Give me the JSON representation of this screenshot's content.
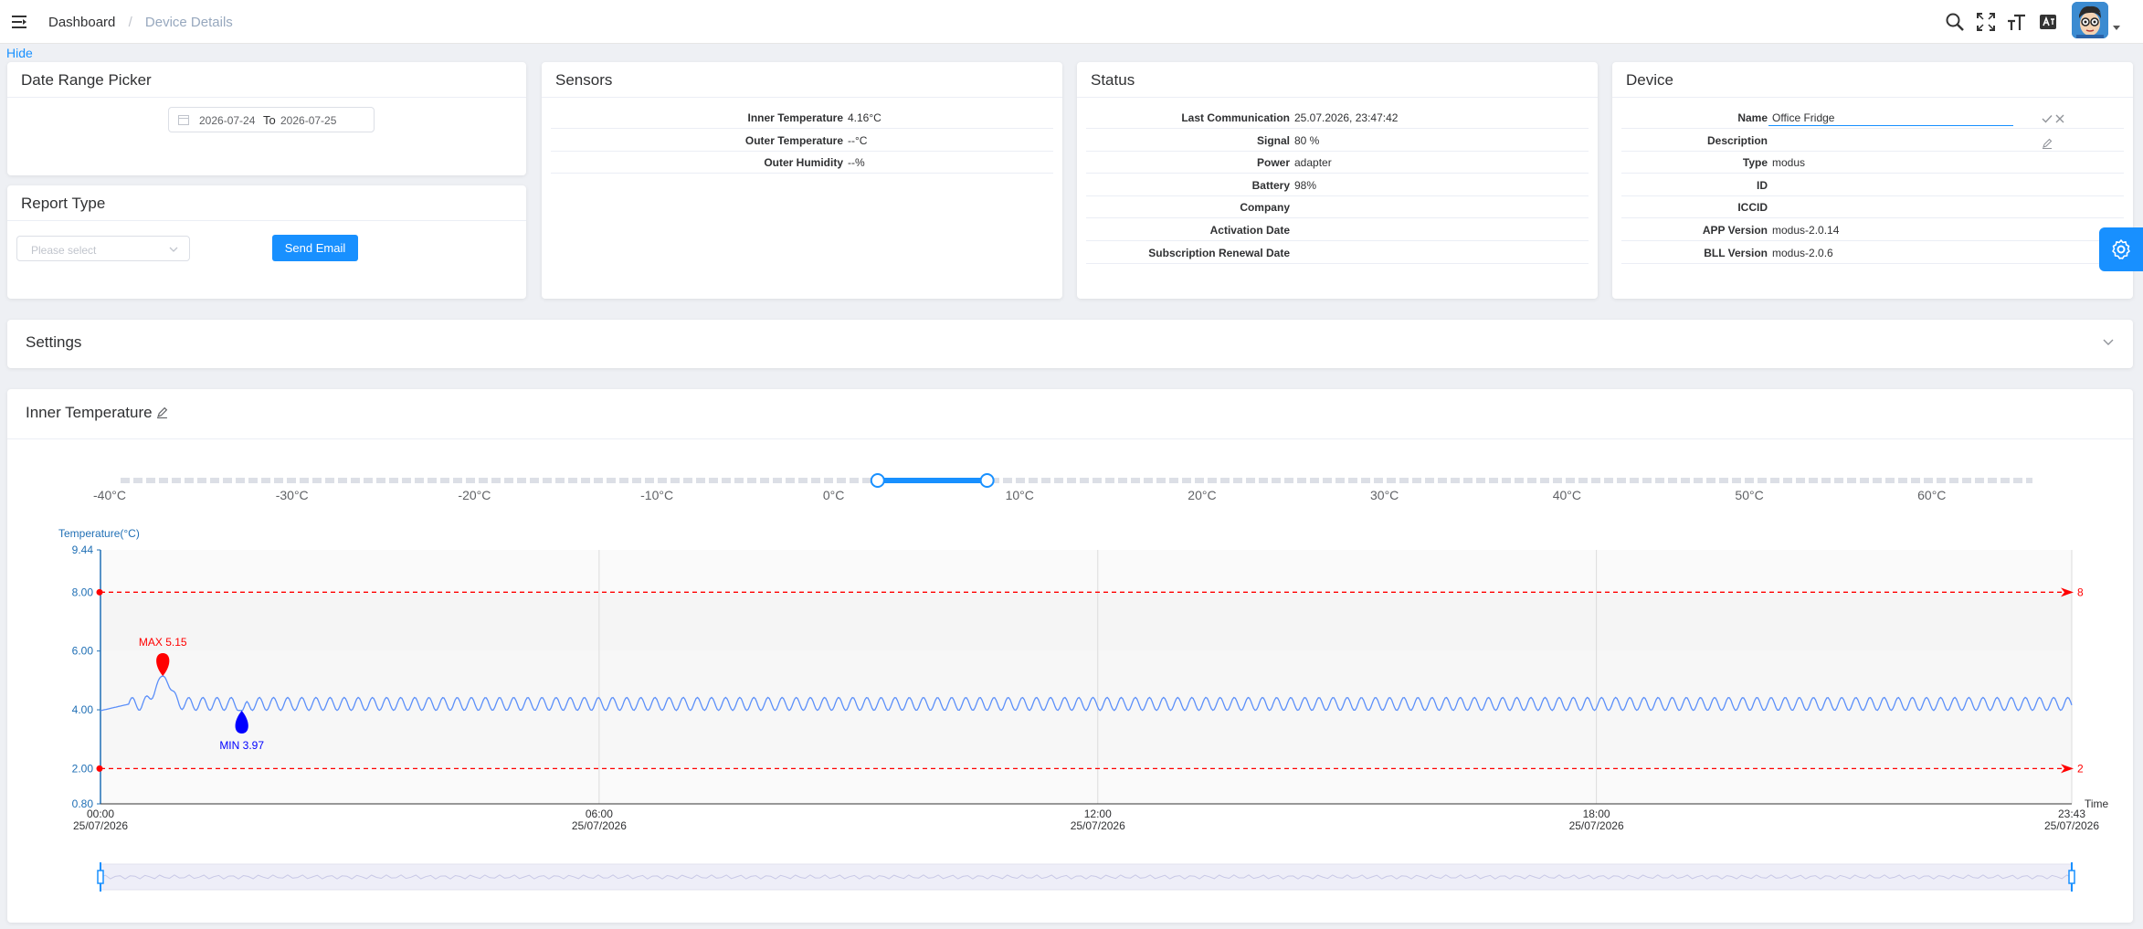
{
  "header": {
    "breadcrumb": [
      "Dashboard",
      "Device Details"
    ],
    "icons": [
      "hamburger-icon",
      "search-icon",
      "fullscreen-icon",
      "font-size-icon",
      "language-icon",
      "avatar"
    ]
  },
  "hide_link": "Hide",
  "date_range": {
    "title": "Date Range Picker",
    "start": "2026-07-24",
    "separator": "To",
    "end": "2026-07-25"
  },
  "report_type": {
    "title": "Report Type",
    "placeholder": "Please select",
    "send_label": "Send Email"
  },
  "sensors": {
    "title": "Sensors",
    "rows": [
      {
        "label": "Inner Temperature",
        "value": "4.16°C"
      },
      {
        "label": "Outer Temperature",
        "value": "--°C"
      },
      {
        "label": "Outer Humidity",
        "value": "--%"
      }
    ]
  },
  "status": {
    "title": "Status",
    "rows": [
      {
        "label": "Last Communication",
        "value": "25.07.2026, 23:47:42"
      },
      {
        "label": "Signal",
        "value": "80 %"
      },
      {
        "label": "Power",
        "value": "adapter"
      },
      {
        "label": "Battery",
        "value": "98%"
      },
      {
        "label": "Company",
        "value": ""
      },
      {
        "label": "Activation Date",
        "value": ""
      },
      {
        "label": "Subscription Renewal Date",
        "value": ""
      }
    ]
  },
  "device": {
    "title": "Device",
    "rows": [
      {
        "label": "Name",
        "value": "Office Fridge"
      },
      {
        "label": "Description",
        "value": ""
      },
      {
        "label": "Type",
        "value": "modus"
      },
      {
        "label": "ID",
        "value": ""
      },
      {
        "label": "ICCID",
        "value": ""
      },
      {
        "label": "APP Version",
        "value": "modus-2.0.14"
      },
      {
        "label": "BLL Version",
        "value": "modus-2.0.6"
      }
    ]
  },
  "settings": {
    "title": "Settings"
  },
  "inner_temp": {
    "title": "Inner Temperature",
    "slider": {
      "scale": [
        "-40°C",
        "-30°C",
        "-20°C",
        "-10°C",
        "0°C",
        "10°C",
        "20°C",
        "30°C",
        "40°C",
        "50°C",
        "60°C"
      ],
      "low": 2,
      "high": 8
    }
  },
  "colors": {
    "accent": "#1890ff",
    "line": "#5b8ff9",
    "alarm": "#ff0000",
    "min": "#0000ff"
  },
  "chart_data": {
    "type": "line",
    "ylabel": "Temperature(°C)",
    "xlabel": "Time",
    "ylim": [
      0.8,
      9.44
    ],
    "y_ticks": [
      "9.44",
      "8.00",
      "6.00",
      "4.00",
      "2.00",
      "0.80"
    ],
    "x_ticks": [
      {
        "time": "00:00",
        "date": "25/07/2026"
      },
      {
        "time": "06:00",
        "date": "25/07/2026"
      },
      {
        "time": "12:00",
        "date": "25/07/2026"
      },
      {
        "time": "18:00",
        "date": "25/07/2026"
      },
      {
        "time": "23:43",
        "date": "25/07/2026"
      }
    ],
    "x_range_hours": [
      0,
      23.72
    ],
    "upper_limit": 8,
    "lower_limit": 2,
    "upper_limit_label": "8",
    "lower_limit_label": "2",
    "max_marker": {
      "label": "MAX 5.15",
      "x_hours": 0.75,
      "value": 5.15
    },
    "min_marker": {
      "label": "MIN 3.97",
      "x_hours": 1.7,
      "value": 3.97
    },
    "series": [
      {
        "period_hours": 0.17,
        "mean": 4.2,
        "amplitude": 0.22,
        "count": 140
      }
    ]
  }
}
